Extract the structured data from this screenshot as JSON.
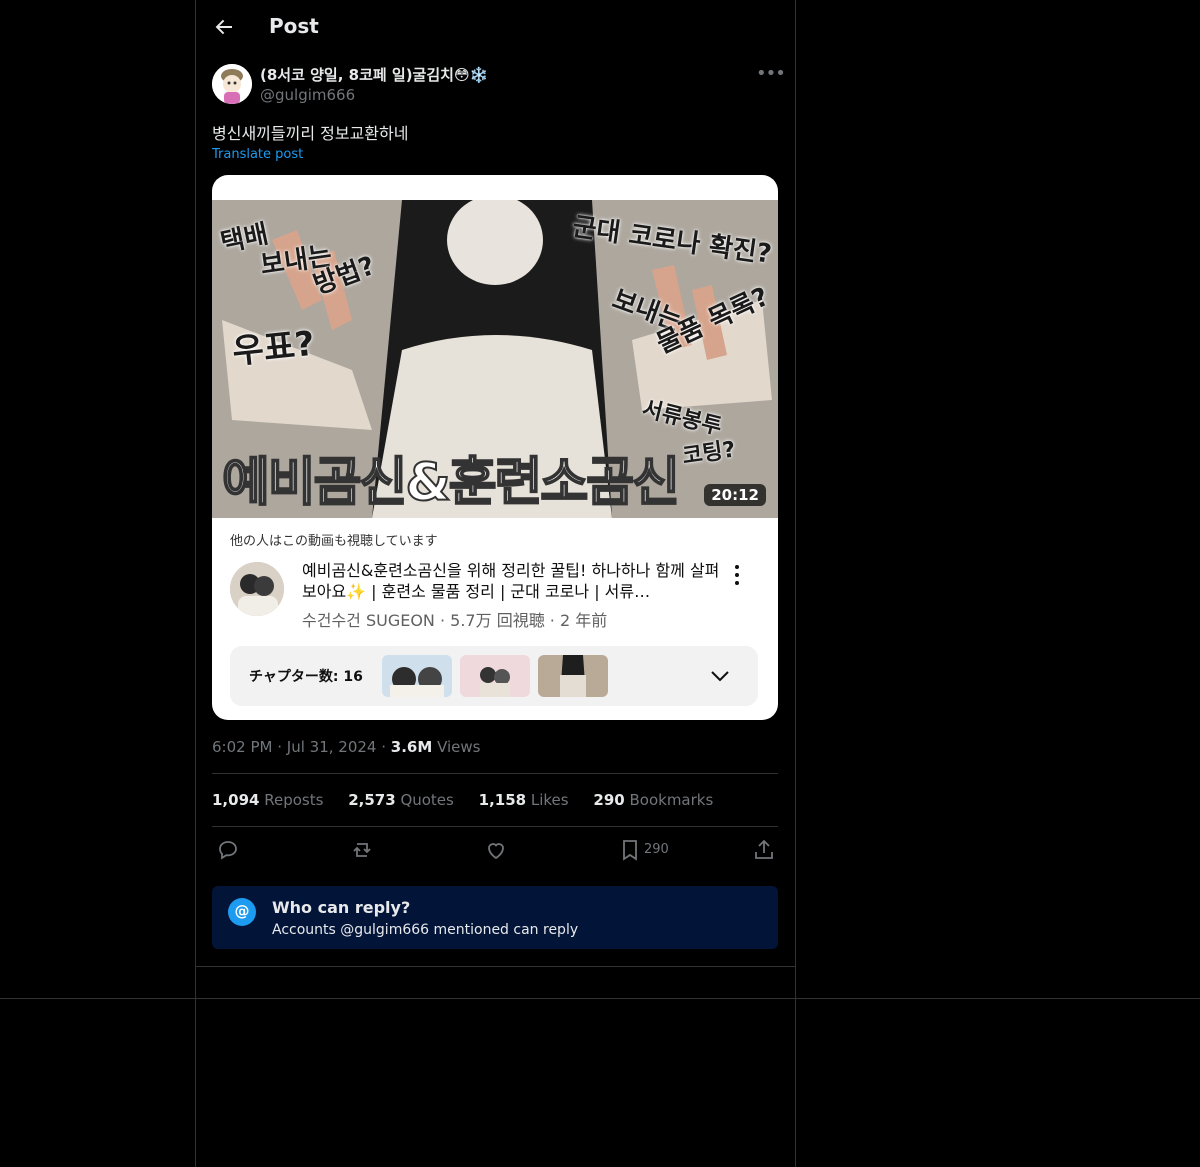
{
  "header": {
    "title": "Post"
  },
  "author": {
    "display_name": "(8서코 양일, 8코페 일)굴김치",
    "emoji": "😳❄️",
    "handle": "@gulgim666"
  },
  "post": {
    "text": "병신새끼들끼리 정보교환하네",
    "translate_label": "Translate post",
    "time": "6:02 PM",
    "date": "Jul 31, 2024",
    "views_count": "3.6M",
    "views_label": "Views"
  },
  "embed": {
    "duration": "20:12",
    "overlay_texts": [
      "택배",
      "보내는",
      "방법?",
      "우표?",
      "군대 코로나 확진?",
      "보내는",
      "물품 목록?",
      "서류봉투",
      "코팅?"
    ],
    "thumbnail_title": "예비곰신&훈련소곰신",
    "others_watching": "他の人はこの動画も視聴しています",
    "video_title": "예비곰신&훈련소곰신을 위해 정리한 꿀팁! 하나하나 함께 살펴보아요✨ | 훈련소 물품 정리 | 군대 코로나 | 서류…",
    "video_meta": "수건수건 SUGEON · 5.7万 回視聴 · 2 年前",
    "chapters_label": "チャプター数: 16"
  },
  "stats": [
    {
      "count": "1,094",
      "label": "Reposts"
    },
    {
      "count": "2,573",
      "label": "Quotes"
    },
    {
      "count": "1,158",
      "label": "Likes"
    },
    {
      "count": "290",
      "label": "Bookmarks"
    }
  ],
  "actions": {
    "bookmark_count": "290"
  },
  "reply_box": {
    "title": "Who can reply?",
    "subtitle": "Accounts @gulgim666 mentioned can reply"
  },
  "colors": {
    "accent": "#1d9bf0",
    "background": "#000000",
    "reply_bg": "#031439"
  }
}
